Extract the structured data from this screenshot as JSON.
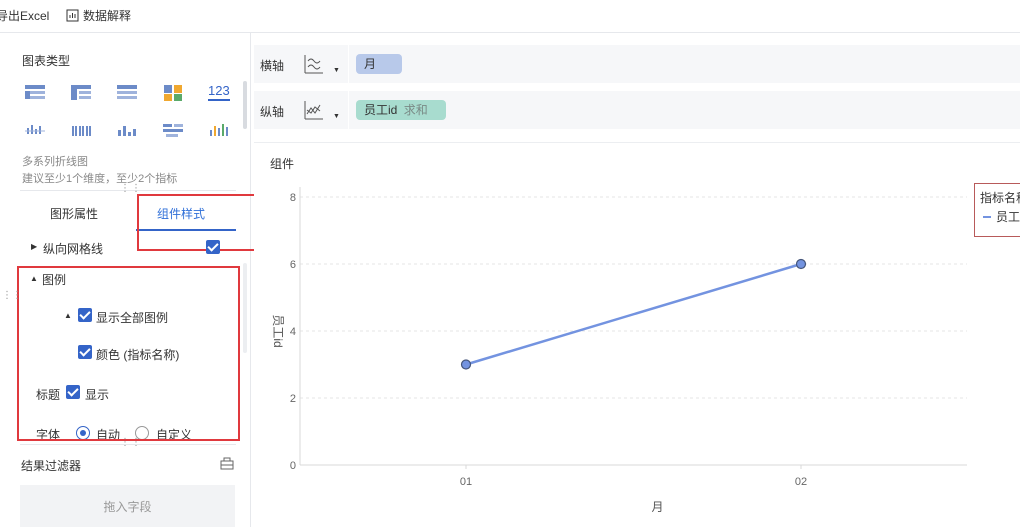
{
  "toolbar": {
    "export_label": "导出Excel",
    "explain_label": "数据解释"
  },
  "left_panel": {
    "chart_type_title": "图表类型",
    "chart_icons_row1": [
      "table-icon",
      "crosstab-icon",
      "list-icon",
      "treemap-icon",
      "number-icon"
    ],
    "number_icon_text": "123",
    "chart_icons_row2": [
      "scatter-bar-icon",
      "grouped-bar-icon",
      "bar-icon",
      "gantt-icon",
      "column-icon"
    ],
    "chart_name": "多系列折线图",
    "chart_hint": "建议至少1个维度，至少2个指标",
    "tabs": [
      "图形属性",
      "组件样式"
    ],
    "active_tab": 1,
    "vertical_grid_label": "纵向网格线",
    "vertical_grid_checked": true,
    "legend_label": "图例",
    "show_all_legend_label": "显示全部图例",
    "color_label": "颜色 (指标名称)",
    "title_label": "标题",
    "title_show_label": "显示",
    "font_label": "字体",
    "font_options": [
      "自动",
      "自定义"
    ],
    "font_selected": "自动",
    "filter_title": "结果过滤器",
    "drop_placeholder": "拖入字段"
  },
  "axes_bar": {
    "x_axis_label": "横轴",
    "x_field": "月",
    "y_axis_label": "纵轴",
    "y_field": "员工id",
    "y_agg": "求和"
  },
  "chart_panel": {
    "component_label": "组件",
    "legend_title": "指标名称",
    "legend_item": "员工"
  },
  "colors": {
    "accent": "#3464c8",
    "line": "#7393e0",
    "x_pill": "#b8c9ea",
    "y_pill": "#a8dccf",
    "highlight": "#e0393e"
  },
  "chart_data": {
    "type": "line",
    "x": [
      "01",
      "02"
    ],
    "series": [
      {
        "name": "员工",
        "values": [
          3,
          6
        ]
      }
    ],
    "xlabel": "月",
    "ylabel": "员工id",
    "ylim": [
      0,
      8
    ],
    "yticks": [
      0,
      2,
      4,
      6,
      8
    ],
    "grid": true,
    "legend": "top-right"
  }
}
